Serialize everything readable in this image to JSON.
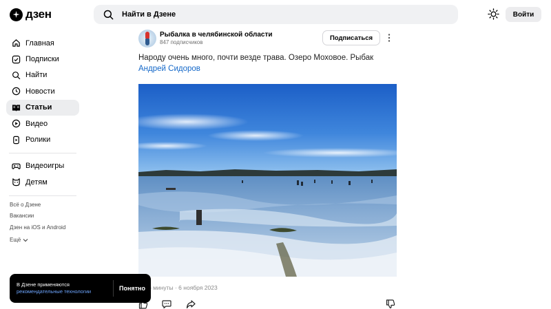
{
  "header": {
    "logo_text": "дзен",
    "search_placeholder": "Найти в Дзене",
    "login_label": "Войти"
  },
  "sidebar": {
    "items": [
      {
        "label": "Главная",
        "icon": "home-icon"
      },
      {
        "label": "Подписки",
        "icon": "subscriptions-icon"
      },
      {
        "label": "Найти",
        "icon": "search-icon"
      },
      {
        "label": "Новости",
        "icon": "news-icon"
      },
      {
        "label": "Статьи",
        "icon": "articles-icon",
        "active": true
      },
      {
        "label": "Видео",
        "icon": "video-icon"
      },
      {
        "label": "Ролики",
        "icon": "shorts-icon"
      }
    ],
    "items2": [
      {
        "label": "Видеоигры",
        "icon": "gamepad-icon"
      },
      {
        "label": "Детям",
        "icon": "kids-icon"
      }
    ],
    "footer_links": [
      "Всё о Дзене",
      "Вакансии",
      "Дзен на iOS и Android",
      "Ещё"
    ]
  },
  "post": {
    "channel_name": "Рыбалка в челябинской области",
    "subscribers": "847 подписчиков",
    "subscribe_label": "Подписаться",
    "text": "Народу очень много, почти везде трава. Озеро Моховое. Рыбак ",
    "author_link": "Андрей Сидоров",
    "meta": "о минуты · 6 ноября 2023"
  },
  "toast": {
    "line1": "В Дзене применяются",
    "link": "рекомендательные технологии",
    "button": "Понятно"
  },
  "colors": {
    "accent_link": "#1468c9",
    "search_bg": "#f0f1f3",
    "active_nav_bg": "#ecedef"
  }
}
